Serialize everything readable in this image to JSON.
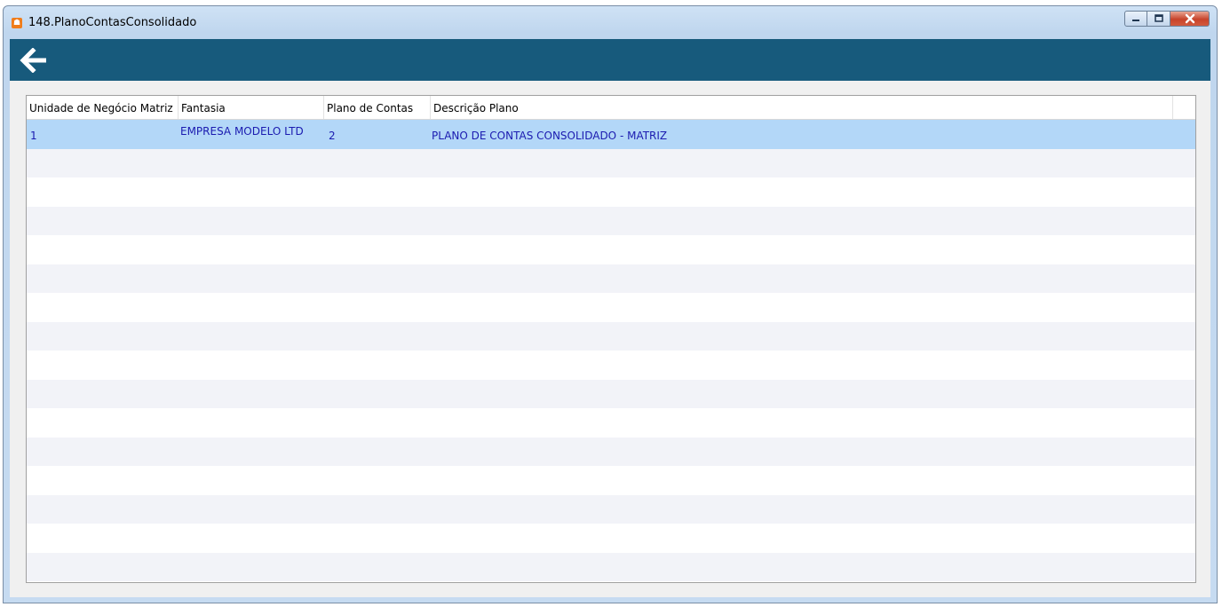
{
  "window": {
    "title": "148.PlanoContasConsolidado",
    "app_icon_glyph": "☗"
  },
  "toolbar": {
    "back_icon": "arrow-left-icon"
  },
  "grid": {
    "columns": [
      "Unidade de Negócio Matriz",
      "Fantasia",
      "Plano de Contas",
      "Descrição Plano"
    ],
    "rows": [
      {
        "unidade": "1",
        "fantasia": "EMPRESA MODELO LTD",
        "plano": "2",
        "descricao": "PLANO DE CONTAS CONSOLIDADO - MATRIZ"
      }
    ]
  },
  "colors": {
    "toolbar_bg": "#175a7c",
    "selected_row": "#b3d7f8",
    "cell_text": "#1b1bb0"
  }
}
